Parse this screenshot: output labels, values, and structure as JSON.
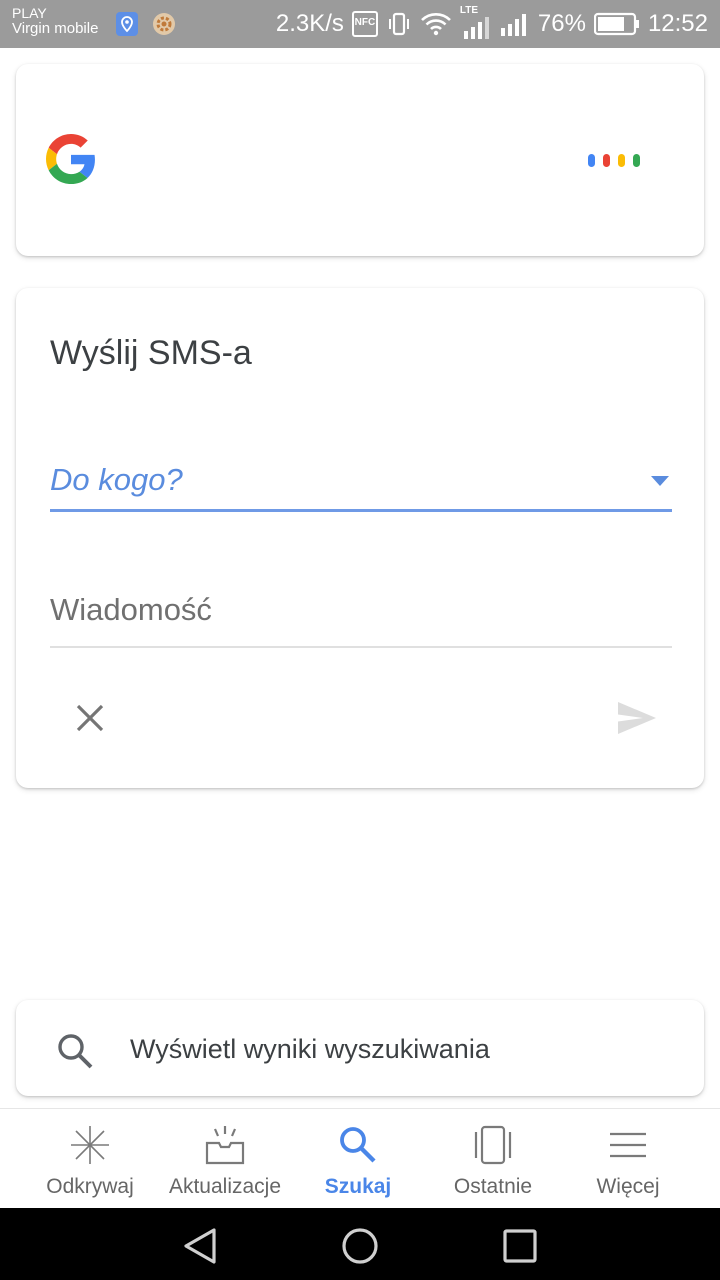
{
  "status_bar": {
    "carrier_line1": "PLAY",
    "carrier_line2": "Virgin mobile",
    "net_speed": "2.3K/s",
    "nfc": "NFC",
    "lte": "LTE",
    "battery_percent": "76%",
    "time": "12:52"
  },
  "assistant_card": {
    "logo_icon": "google-g-icon",
    "assistant_dot_colors": [
      "#4285F4",
      "#EA4335",
      "#FBBC05",
      "#34A853"
    ]
  },
  "sms_card": {
    "title": "Wyślij SMS-a",
    "to_placeholder": "Do kogo?",
    "message_placeholder": "Wiadomość",
    "accent_color": "#4a86e8"
  },
  "search_results": {
    "label": "Wyświetl wyniki wyszukiwania"
  },
  "bottom_nav": {
    "items": [
      {
        "label": "Odkrywaj",
        "icon": "sparkle-icon"
      },
      {
        "label": "Aktualizacje",
        "icon": "inbox-icon"
      },
      {
        "label": "Szukaj",
        "icon": "search-icon",
        "active": true
      },
      {
        "label": "Ostatnie",
        "icon": "recent-cards-icon"
      },
      {
        "label": "Więcej",
        "icon": "menu-icon"
      }
    ]
  }
}
